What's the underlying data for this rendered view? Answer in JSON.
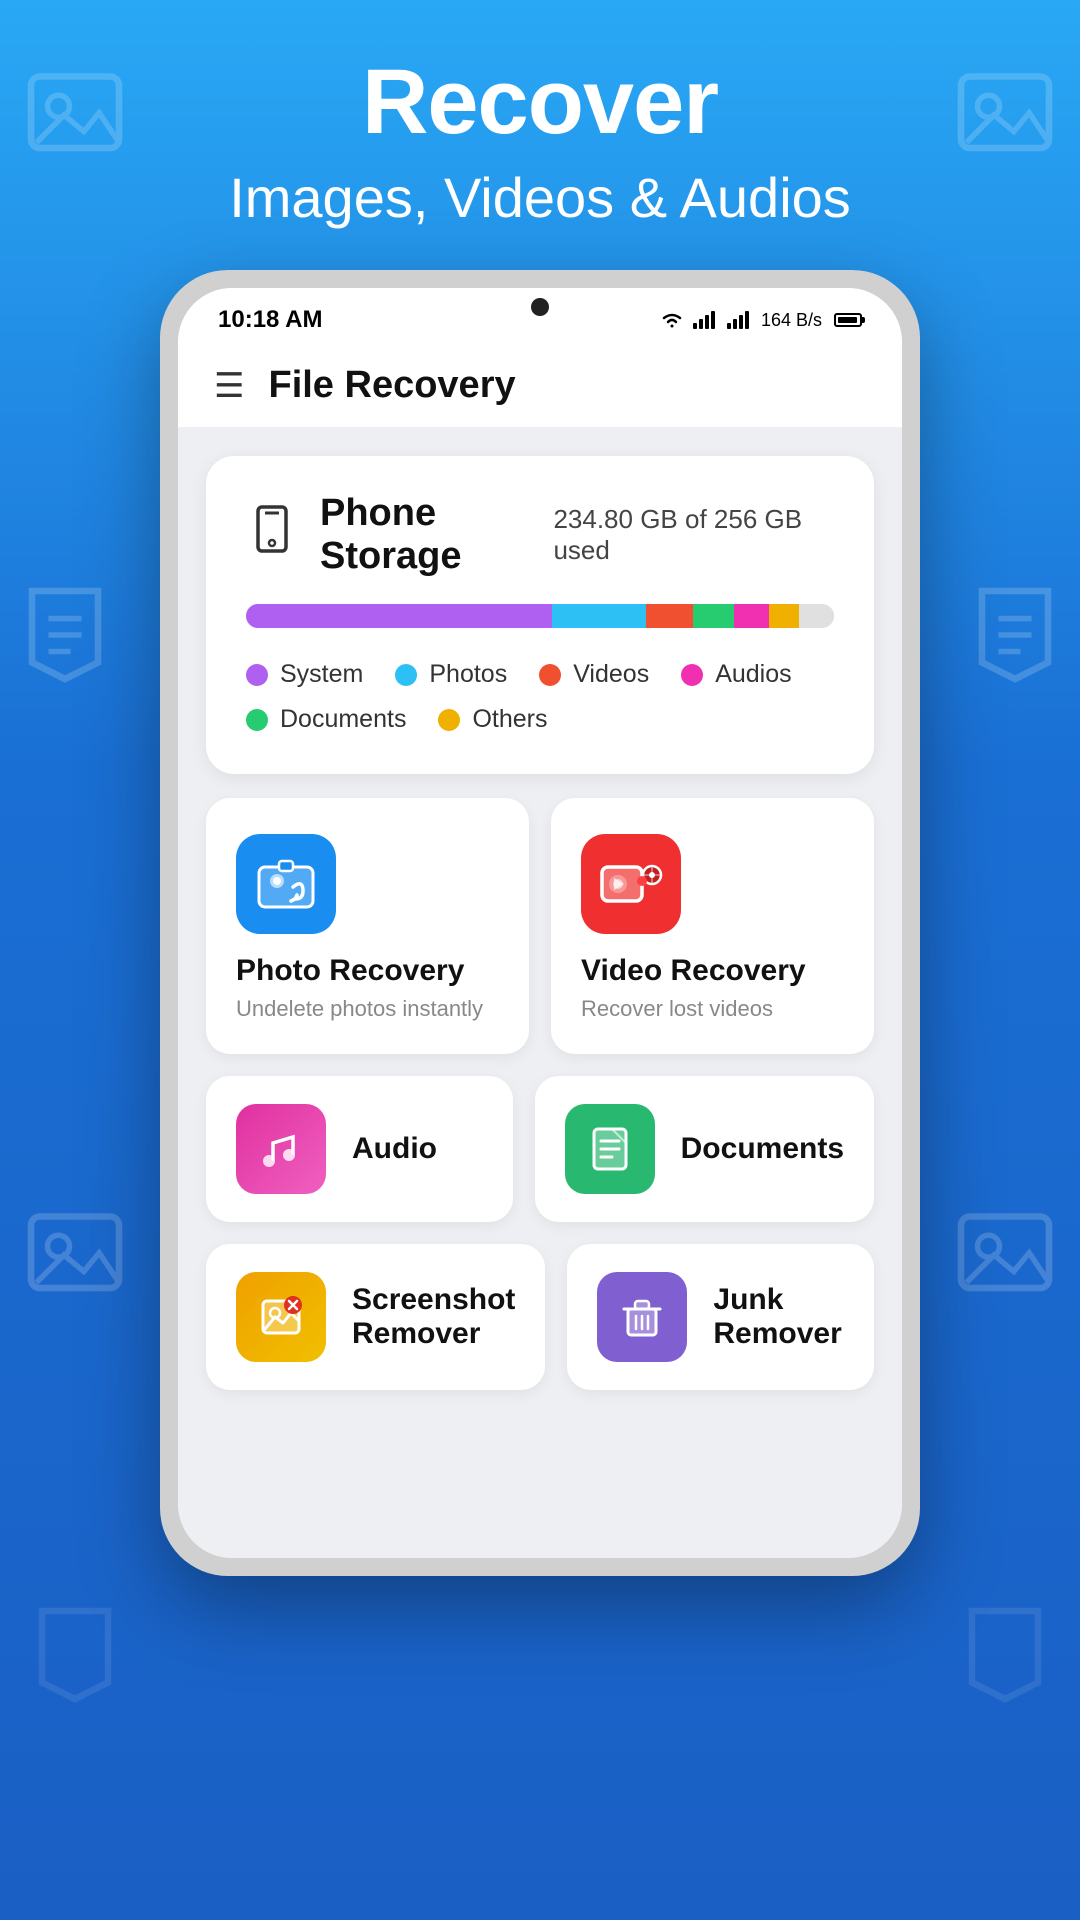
{
  "header": {
    "title": "Recover",
    "subtitle": "Images, Videos & Audios"
  },
  "phone": {
    "status_bar": {
      "time": "10:18 AM",
      "network_speed": "164 B/s"
    },
    "app_bar": {
      "title": "File Recovery"
    },
    "storage": {
      "title": "Phone Storage",
      "usage_text": "234.80 GB of 256 GB used",
      "bar": {
        "system_pct": 52,
        "photos_pct": 16,
        "videos_pct": 8,
        "audio_pct": 7,
        "docs_pct": 6,
        "others_pct": 5
      },
      "legend": [
        {
          "label": "System",
          "color": "#b060f0"
        },
        {
          "label": "Photos",
          "color": "#2dc0f5"
        },
        {
          "label": "Videos",
          "color": "#f05030"
        },
        {
          "label": "Audios",
          "color": "#f030b0"
        },
        {
          "label": "Documents",
          "color": "#28cc70"
        },
        {
          "label": "Others",
          "color": "#f0b000"
        }
      ]
    },
    "features": [
      {
        "id": "photo-recovery",
        "title": "Photo Recovery",
        "subtitle": "Undelete photos instantly",
        "icon_type": "photo"
      },
      {
        "id": "video-recovery",
        "title": "Video Recovery",
        "subtitle": "Recover lost videos",
        "icon_type": "video"
      }
    ],
    "tools": [
      {
        "id": "audio",
        "title": "Audio",
        "icon_type": "audio"
      },
      {
        "id": "documents",
        "title": "Documents",
        "icon_type": "docs"
      },
      {
        "id": "screenshot-remover",
        "title": "Screenshot Remover",
        "icon_type": "screenshot"
      },
      {
        "id": "junk-remover",
        "title": "Junk Remover",
        "icon_type": "junk"
      }
    ]
  }
}
